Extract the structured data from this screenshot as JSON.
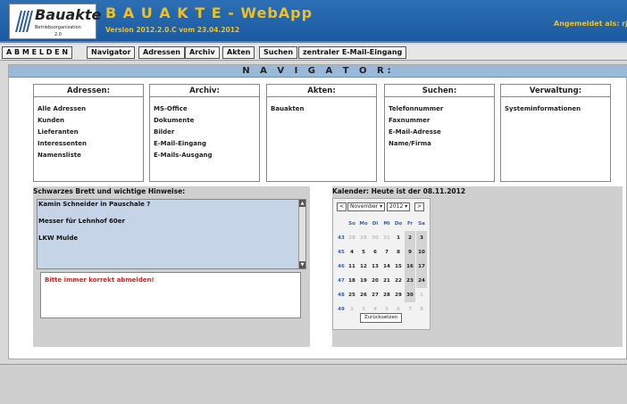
{
  "header": {
    "logo_title": "Bauakte",
    "logo_subtitle": "Betriebsorganisation",
    "logo_version": "2.0",
    "app_title": "B A U A K T E - WebApp",
    "app_version": "Version 2012.2.0.C vom 23.04.2012",
    "user_info": "Angemeldet als: rjent"
  },
  "menu": {
    "logout": "A B M E L D E N",
    "navigator": "Navigator",
    "adressen": "Adressen",
    "archiv": "Archiv",
    "akten": "Akten",
    "suchen": "Suchen",
    "email": "zentraler E-Mail-Eingang"
  },
  "navigator": {
    "title": "N A V I G A T O R:",
    "sections": [
      {
        "title": "Adressen:",
        "links": [
          "Alle Adressen",
          "Kunden",
          "Lieferanten",
          "Interessenten",
          "Namensliste"
        ]
      },
      {
        "title": "Archiv:",
        "links": [
          "MS-Office",
          "Dokumente",
          "Bilder",
          "E-Mail-Eingang",
          "E-Mails-Ausgang"
        ]
      },
      {
        "title": "Akten:",
        "links": [
          "Bauakten"
        ]
      },
      {
        "title": "Suchen:",
        "links": [
          "Telefonnummer",
          "Faxnummer",
          "E-Mail-Adresse",
          "Name/Firma"
        ]
      },
      {
        "title": "Verwaltung:",
        "links": [
          "Systeminformationen"
        ]
      }
    ]
  },
  "board": {
    "title": "Schwarzes Brett und wichtige Hinweise:",
    "items": [
      "Kamin Schneider  in Pauschale ?",
      "Messer für Lehnhof 60er",
      "LKW Mulde"
    ],
    "note": "Bitte immer korrekt abmelden!"
  },
  "calendar": {
    "title": "Kalender: Heute ist der 08.11.2012",
    "prev": "<",
    "month": "November",
    "year": "2012",
    "next": ">",
    "weekdays": [
      "So",
      "Mo",
      "Di",
      "Mi",
      "Do",
      "Fr",
      "Sa"
    ],
    "weeks": [
      {
        "week": "43",
        "days": [
          "28",
          "29",
          "30",
          "31",
          "1",
          "2",
          "3"
        ]
      },
      {
        "week": "45",
        "days": [
          "4",
          "5",
          "6",
          "7",
          "8",
          "9",
          "10"
        ]
      },
      {
        "week": "46",
        "days": [
          "11",
          "12",
          "13",
          "14",
          "15",
          "16",
          "17"
        ]
      },
      {
        "week": "47",
        "days": [
          "18",
          "19",
          "20",
          "21",
          "22",
          "23",
          "24"
        ]
      },
      {
        "week": "48",
        "days": [
          "25",
          "26",
          "27",
          "28",
          "29",
          "30",
          "1"
        ]
      },
      {
        "week": "49",
        "days": [
          "2",
          "3",
          "4",
          "5",
          "6",
          "7",
          "8"
        ]
      }
    ],
    "reset": "Zurücksetzen"
  }
}
